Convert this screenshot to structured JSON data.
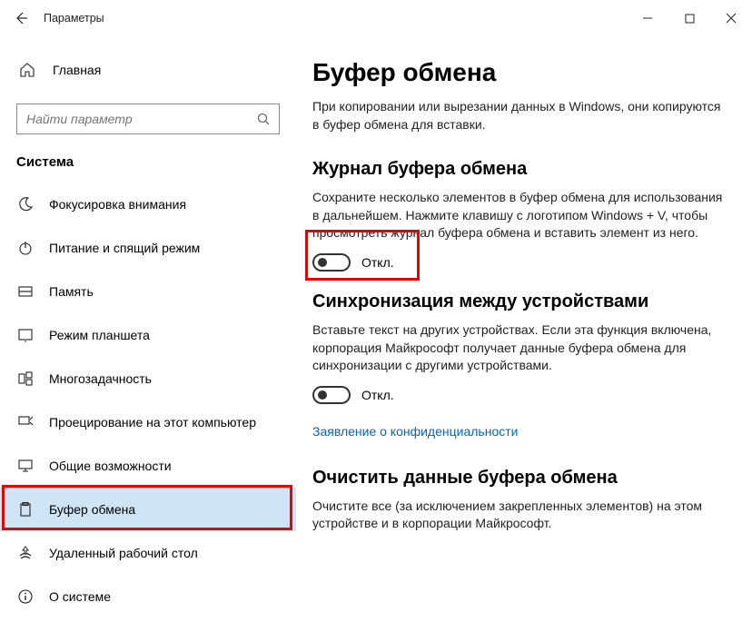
{
  "window": {
    "title": "Параметры"
  },
  "sidebar": {
    "home_label": "Главная",
    "search_placeholder": "Найти параметр",
    "group_label": "Система",
    "items": [
      {
        "icon": "moon-icon",
        "label": "Фокусировка внимания"
      },
      {
        "icon": "power-icon",
        "label": "Питание и спящий режим"
      },
      {
        "icon": "storage-icon",
        "label": "Память"
      },
      {
        "icon": "tablet-icon",
        "label": "Режим планшета"
      },
      {
        "icon": "multitask-icon",
        "label": "Многозадачность"
      },
      {
        "icon": "project-icon",
        "label": "Проецирование на этот компьютер"
      },
      {
        "icon": "shared-icon",
        "label": "Общие возможности"
      },
      {
        "icon": "clipboard-icon",
        "label": "Буфер обмена",
        "selected": true
      },
      {
        "icon": "remote-icon",
        "label": "Удаленный рабочий стол"
      },
      {
        "icon": "about-icon",
        "label": "О системе"
      }
    ]
  },
  "main": {
    "title": "Буфер обмена",
    "intro": "При копировании или вырезании данных в Windows, они копируются в буфер обмена для вставки.",
    "history": {
      "heading": "Журнал буфера обмена",
      "desc": "Сохраните несколько элементов в буфер обмена для использования в дальнейшем. Нажмите клавишу с логотипом Windows + V, чтобы просмотреть журнал буфера обмена и вставить элемент из него.",
      "state": "Откл."
    },
    "sync": {
      "heading": "Синхронизация между устройствами",
      "desc": "Вставьте текст на других устройствах. Если эта функция включена, корпорация Майкрософт получает данные буфера обмена для синхронизации с другими устройствами.",
      "state": "Откл.",
      "privacy_link": "Заявление о конфиденциальности"
    },
    "clear": {
      "heading": "Очистить данные буфера обмена",
      "desc": "Очистите все (за исключением закрепленных элементов) на этом устройстве и в корпорации Майкрософт."
    }
  }
}
